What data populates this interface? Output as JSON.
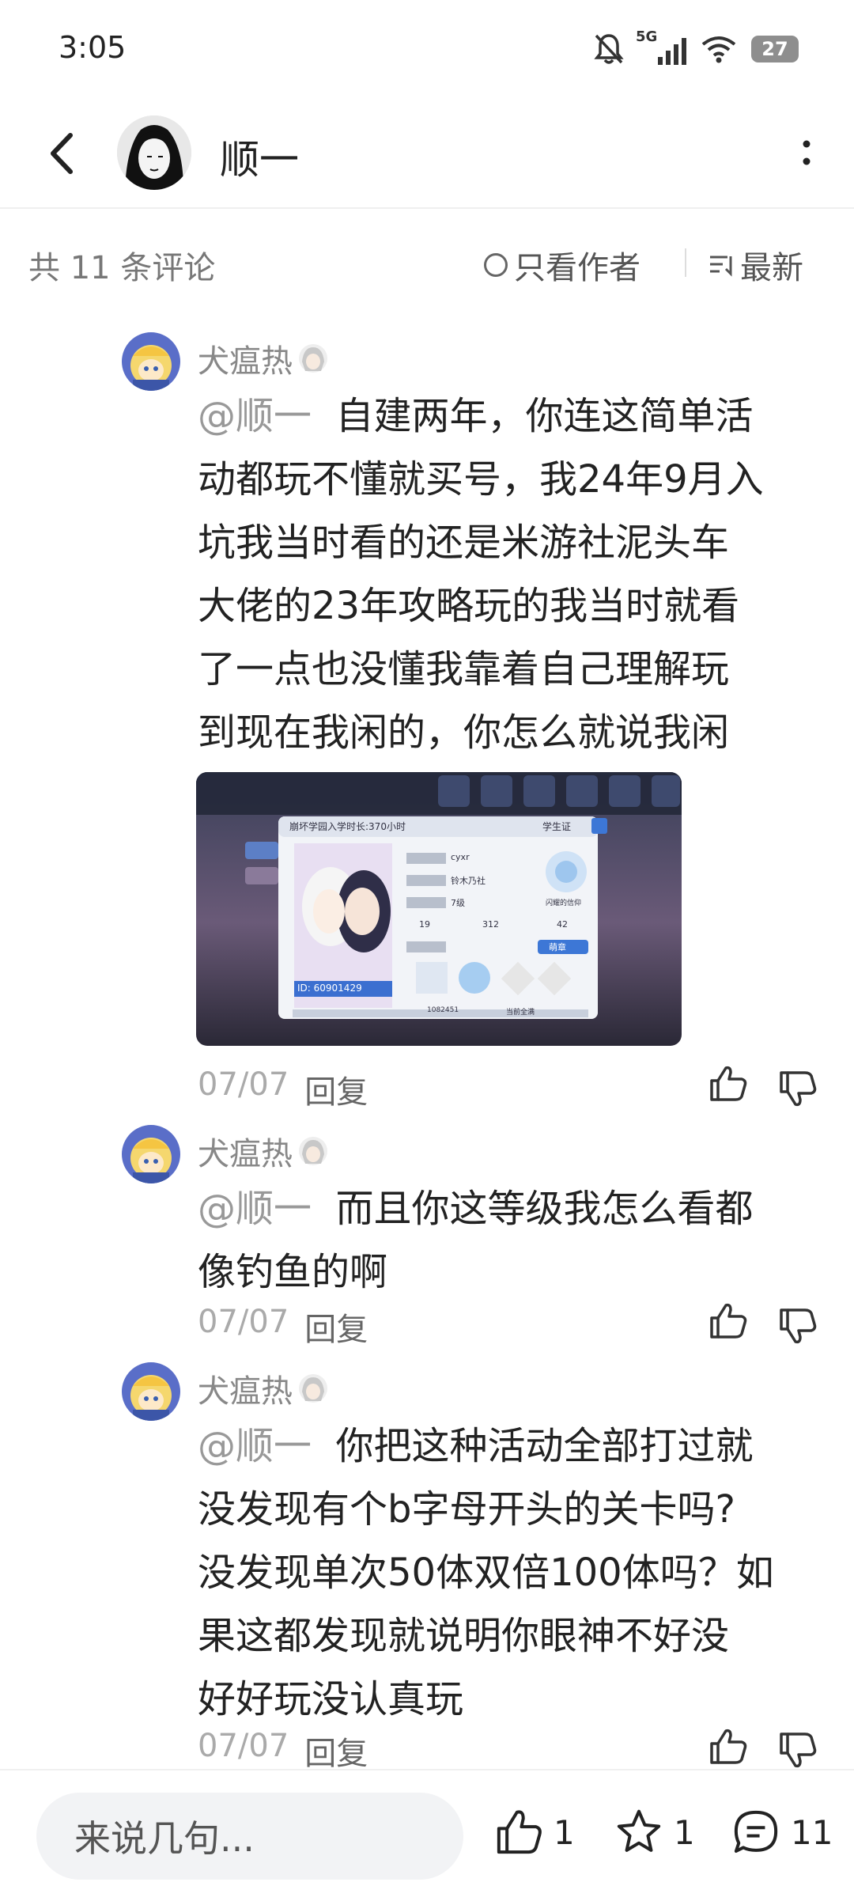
{
  "status_bar": {
    "time": "3:05",
    "battery": "27",
    "network": "5G"
  },
  "header": {
    "title": "顺一"
  },
  "subbar": {
    "count_text": "共 11 条评论",
    "author_only": "只看作者",
    "sort": "最新"
  },
  "comments": [
    {
      "username": "犬瘟热",
      "mention": "@顺一",
      "lines": [
        "自建两年，你连这简单活",
        "动都玩不懂就买号，我24年9月入",
        "坑我当时看的还是米游社泥头车",
        "大佬的23年攻略玩的我当时就看",
        "了一点也没懂我靠着自己理解玩",
        "到现在我闲的，你怎么就说我闲"
      ],
      "date": "07/07",
      "reply": "回复",
      "image": {
        "title": "崩坏学园入学时长:370小时",
        "card": "学生证",
        "name": "cyxr",
        "club": "铃木乃社",
        "level": "7级",
        "n1": "19",
        "n2": "312",
        "n3": "42",
        "id": "ID: 60901429",
        "score": "1082451",
        "status": "当前全满",
        "dropdown": "萌章",
        "badge_label": "闪耀的信仰"
      }
    },
    {
      "username": "犬瘟热",
      "mention": "@顺一",
      "lines": [
        "而且你这等级我怎么看都",
        "像钓鱼的啊"
      ],
      "date": "07/07",
      "reply": "回复"
    },
    {
      "username": "犬瘟热",
      "mention": "@顺一",
      "lines": [
        "你把这种活动全部打过就",
        "没发现有个b字母开头的关卡吗?",
        "没发现单次50体双倍100体吗？如",
        "果这都发现就说明你眼神不好没",
        "好好玩没认真玩"
      ],
      "date": "07/07",
      "reply": "回复"
    }
  ],
  "bottom_bar": {
    "placeholder": "来说几句...",
    "likes": "1",
    "favorites": "1",
    "comments": "11"
  }
}
